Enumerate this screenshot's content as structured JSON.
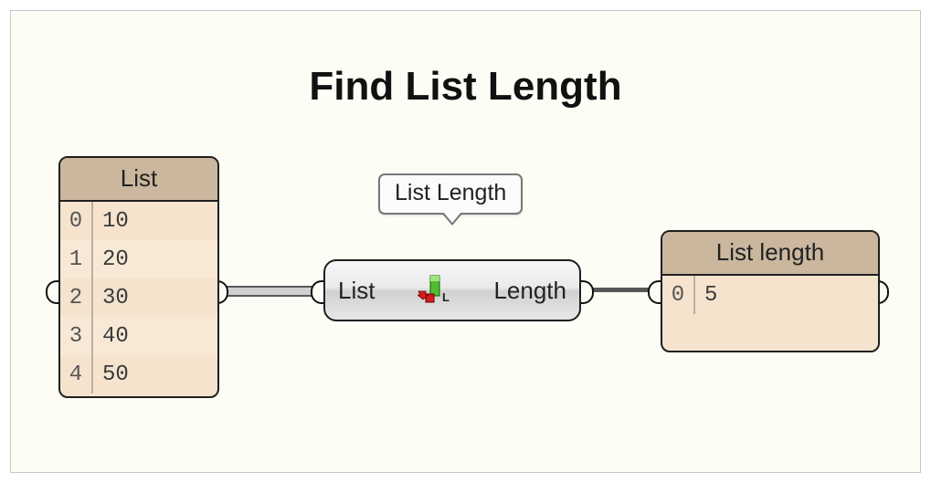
{
  "title": "Find List Length",
  "input_panel": {
    "header": "List",
    "rows": [
      {
        "index": "0",
        "value": "10"
      },
      {
        "index": "1",
        "value": "20"
      },
      {
        "index": "2",
        "value": "30"
      },
      {
        "index": "3",
        "value": "40"
      },
      {
        "index": "4",
        "value": "50"
      }
    ]
  },
  "component": {
    "tooltip": "List Length",
    "input_label": "List",
    "output_label": "Length",
    "icon_letter": "L"
  },
  "output_panel": {
    "header": "List length",
    "rows": [
      {
        "index": "0",
        "value": "5"
      }
    ]
  }
}
